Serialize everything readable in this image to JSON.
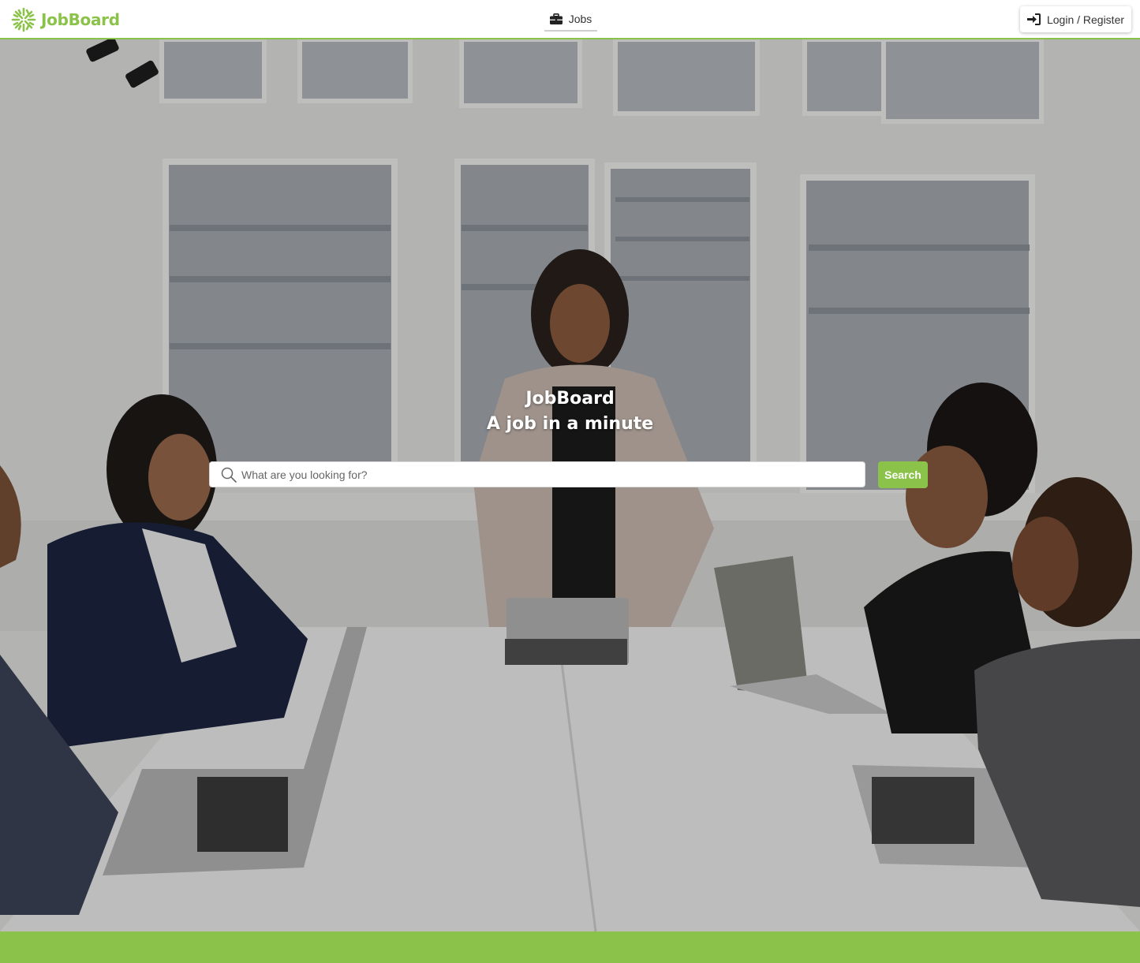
{
  "brand": {
    "name": "JobBoard",
    "accent_color": "#8bc34a",
    "logo_icon": "jobboard-logo-icon"
  },
  "nav": {
    "jobs_label": "Jobs",
    "jobs_icon": "briefcase-icon"
  },
  "auth": {
    "login_label": "Login / Register",
    "login_icon": "sign-in-icon"
  },
  "hero": {
    "title": "JobBoard",
    "subtitle": "A job in a minute",
    "background": "office-meeting-photo"
  },
  "search": {
    "placeholder": "What are you looking for?",
    "value": "",
    "button_label": "Search",
    "icon": "search-icon"
  },
  "footer": {
    "color": "#8bc34a"
  }
}
